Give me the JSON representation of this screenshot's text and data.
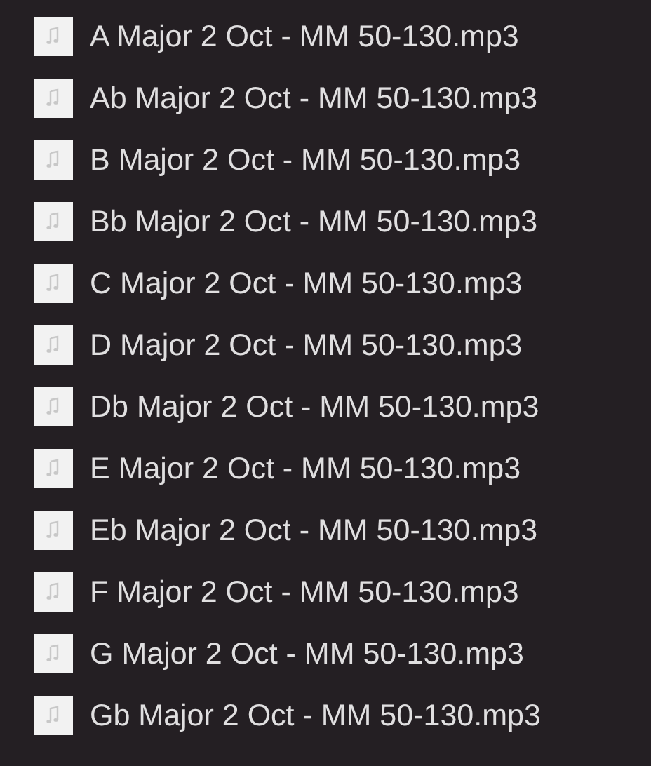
{
  "files": [
    {
      "name": "A Major 2 Oct - MM 50-130.mp3"
    },
    {
      "name": "Ab Major 2 Oct - MM 50-130.mp3"
    },
    {
      "name": "B Major 2 Oct - MM 50-130.mp3"
    },
    {
      "name": "Bb Major 2 Oct - MM 50-130.mp3"
    },
    {
      "name": "C Major 2 Oct - MM 50-130.mp3"
    },
    {
      "name": "D Major 2 Oct - MM 50-130.mp3"
    },
    {
      "name": "Db Major 2 Oct - MM 50-130.mp3"
    },
    {
      "name": "E Major 2 Oct - MM 50-130.mp3"
    },
    {
      "name": "Eb Major 2 Oct - MM 50-130.mp3"
    },
    {
      "name": "F Major 2 Oct - MM 50-130.mp3"
    },
    {
      "name": "G Major 2 Oct - MM 50-130.mp3"
    },
    {
      "name": "Gb Major 2 Oct - MM 50-130.mp3"
    }
  ]
}
